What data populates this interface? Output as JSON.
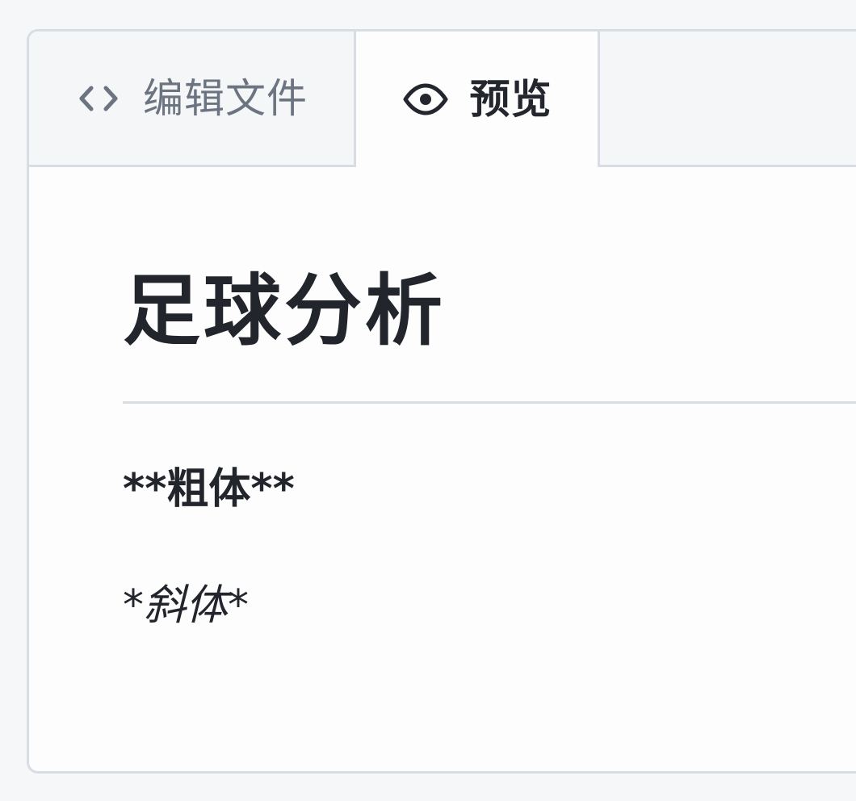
{
  "tabs": {
    "edit": {
      "label": "编辑文件",
      "icon": "code-icon"
    },
    "preview": {
      "label": "预览",
      "icon": "eye-icon",
      "active": true
    }
  },
  "preview": {
    "title": "足球分析",
    "bold_text": "**粗体**",
    "italic_text": "*斜体*"
  },
  "colors": {
    "page_background": "#f6f7f9",
    "panel_background": "#fdfdfe",
    "border": "#d8dde3",
    "inactive_tab_text": "#6b7480",
    "active_text": "#23272d"
  }
}
